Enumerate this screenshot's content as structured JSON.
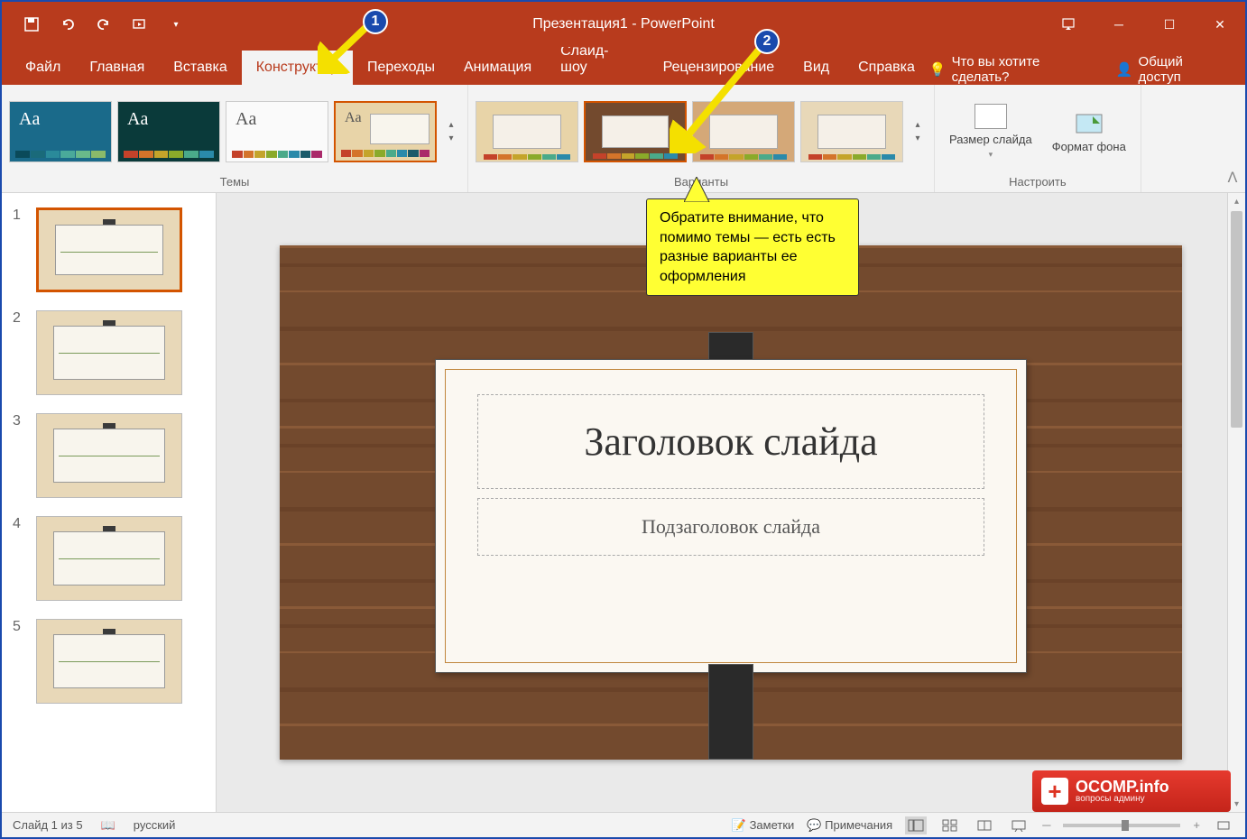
{
  "title": "Презентация1 - PowerPoint",
  "tabs": {
    "file": "Файл",
    "home": "Главная",
    "insert": "Вставка",
    "design": "Конструктор",
    "transitions": "Переходы",
    "animations": "Анимация",
    "slideshow": "Слайд-шоу",
    "review": "Рецензирование",
    "view": "Вид",
    "help": "Справка"
  },
  "tell_me": "Что вы хотите сделать?",
  "share": "Общий доступ",
  "ribbon": {
    "themes_label": "Темы",
    "variants_label": "Варианты",
    "customize_label": "Настроить",
    "slide_size": "Размер слайда",
    "format_bg": "Формат фона"
  },
  "slide": {
    "title_placeholder": "Заголовок слайда",
    "subtitle_placeholder": "Подзаголовок слайда"
  },
  "status": {
    "slide_counter": "Слайд 1 из 5",
    "language": "русский",
    "notes": "Заметки",
    "comments": "Примечания"
  },
  "slide_count": 5,
  "callout": {
    "text": "Обратите внимание, что помимо темы — есть есть разные варианты ее оформления"
  },
  "annotations": {
    "num1": "1",
    "num2": "2"
  },
  "watermark": {
    "main": "OCOMP.info",
    "sub": "вопросы админу"
  },
  "palette": [
    "#1a5a6a",
    "#2a8aaa",
    "#4aaa8a",
    "#8aaa2a",
    "#c4a42a",
    "#d4742a",
    "#c4422a",
    "#aa2a6a"
  ]
}
